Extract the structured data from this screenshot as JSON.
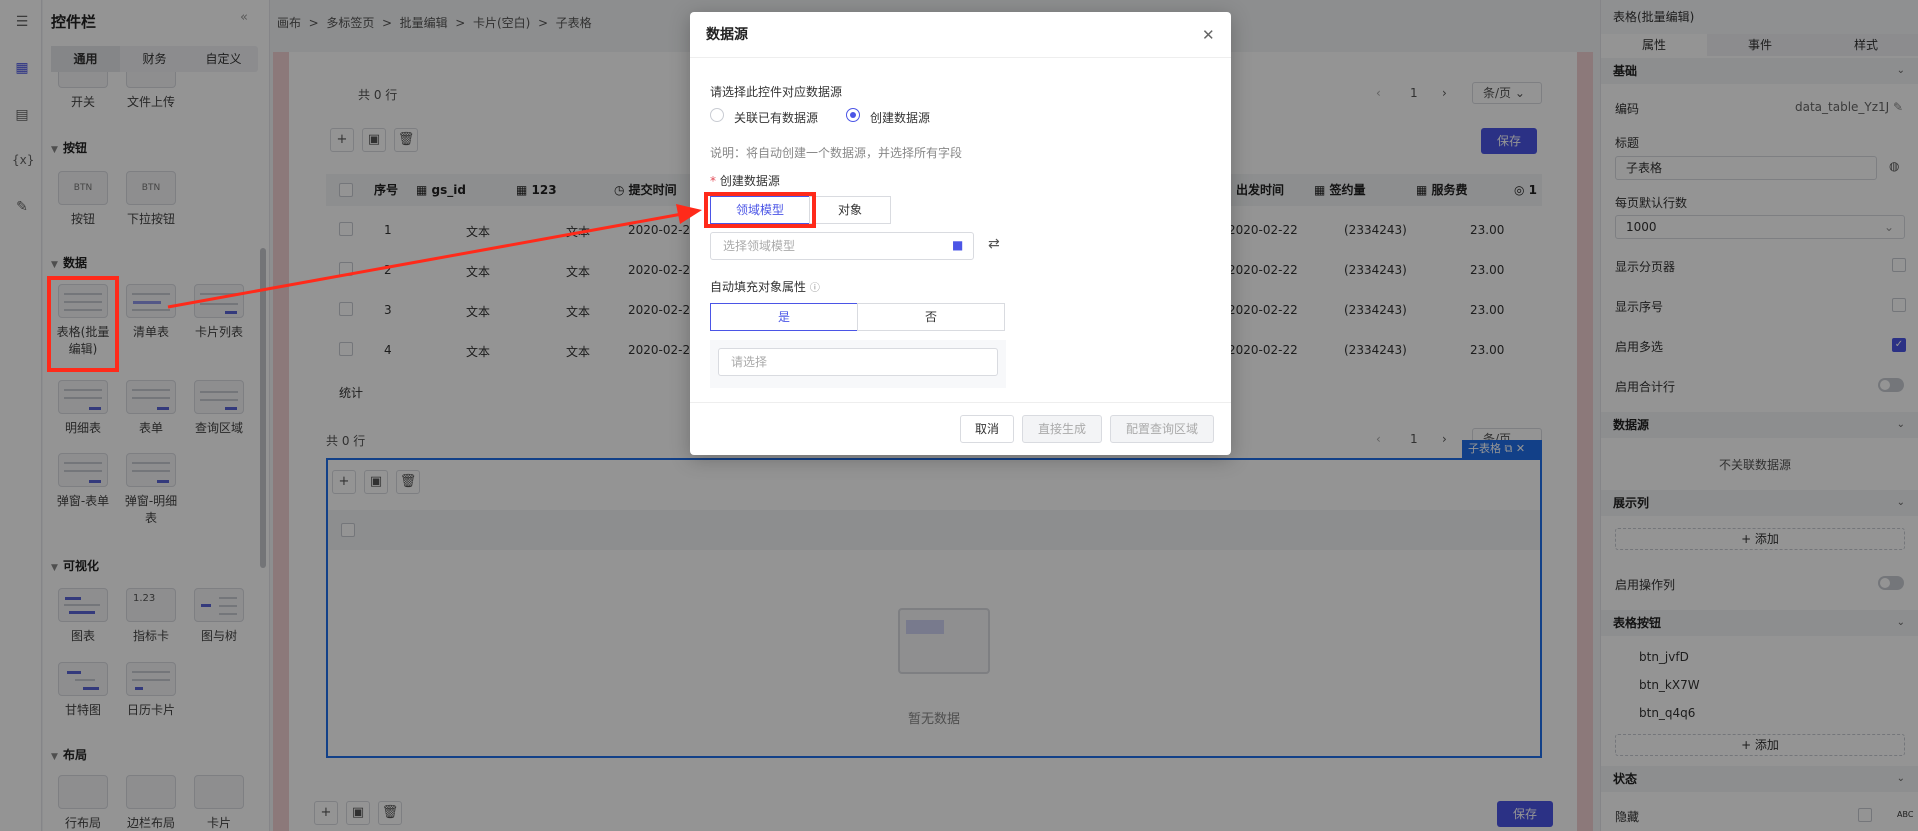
{
  "rail": {
    "icons": [
      "outline-icon",
      "components-icon",
      "datasource-icon",
      "variable-icon",
      "edit-icon"
    ],
    "variable_label": "{x}"
  },
  "widgets": {
    "title": "控件栏",
    "tabs": [
      "通用",
      "财务",
      "自定义"
    ],
    "top_items": [
      "开关",
      "文件上传"
    ],
    "sections": {
      "button": "按钮",
      "data": "数据",
      "visual": "可视化",
      "layout": "布局"
    },
    "button_items": [
      "按钮",
      "下拉按钮"
    ],
    "button_thumbs": [
      "BTN",
      "BTN"
    ],
    "data_items": [
      "表格(批量编辑)",
      "清单表",
      "卡片列表",
      "明细表",
      "表单",
      "查询区域",
      "弹窗-表单",
      "弹窗-明细表"
    ],
    "visual_items": [
      "图表",
      "指标卡",
      "图与树",
      "甘特图",
      "日历卡片"
    ],
    "visual_thumb_num": "1.23",
    "layout_items": [
      "行布局",
      "边栏布局",
      "卡片"
    ]
  },
  "breadcrumb": [
    "画布",
    "多标签页",
    "批量编辑",
    "卡片(空白)",
    "子表格"
  ],
  "canvas": {
    "total_rows": "共 0 行",
    "page": "1",
    "page_size": "条/页",
    "save": "保存",
    "columns": [
      "序号",
      "gs_id",
      "123",
      "提交时间",
      "出发时间",
      "签约量",
      "服务费"
    ],
    "rows": [
      {
        "no": "1",
        "a": "文本",
        "b": "文本",
        "c": "2020-02-22",
        "d": "2020-02-22",
        "e": "(2334243)",
        "f": "23.00"
      },
      {
        "no": "2",
        "a": "文本",
        "b": "文本",
        "c": "2020-02-22",
        "d": "2020-02-22",
        "e": "(2334243)",
        "f": "23.00"
      },
      {
        "no": "3",
        "a": "文本",
        "b": "文本",
        "c": "2020-02-22",
        "d": "2020-02-22",
        "e": "(2334243)",
        "f": "23.00"
      },
      {
        "no": "4",
        "a": "文本",
        "b": "文本",
        "c": "2020-02-22",
        "d": "2020-02-22",
        "e": "(2334243)",
        "f": "23.00"
      }
    ],
    "summary": "统计",
    "sub_tag": "子表格",
    "empty": "暂无数据",
    "page_size_short": "条/页"
  },
  "dialog": {
    "title": "数据源",
    "prompt": "请选择此控件对应数据源",
    "opt_link": "关联已有数据源",
    "opt_create": "创建数据源",
    "note": "说明：将自动创建一个数据源，并选择所有字段",
    "create_label": "创建数据源",
    "required": "*",
    "seg_domain": "领域模型",
    "seg_object": "对象",
    "model_placeholder": "选择领域模型",
    "autofill_label": "自动填充对象属性",
    "yes": "是",
    "no": "否",
    "select_placeholder": "请选择",
    "cancel": "取消",
    "generate": "直接生成",
    "config_query": "配置查询区域"
  },
  "props": {
    "header": "表格(批量编辑)",
    "tabs": [
      "属性",
      "事件",
      "样式"
    ],
    "sec_basic": "基础",
    "code_label": "编码",
    "code_value": "data_table_Yz1J",
    "title_label": "标题",
    "title_value": "子表格",
    "page_size_label": "每页默认行数",
    "page_size_value": "1000",
    "show_pager": "显示分页器",
    "show_index": "显示序号",
    "multi_select": "启用多选",
    "total_row": "启用合计行",
    "sec_datasource": "数据源",
    "no_datasource": "不关联数据源",
    "sec_columns": "展示列",
    "add": "+ 添加",
    "op_column": "启用操作列",
    "sec_buttons": "表格按钮",
    "buttons": [
      "btn_jvfD",
      "btn_kX7W",
      "btn_q4q6"
    ],
    "sec_state": "状态",
    "hidden": "隐藏",
    "abc": "ABC"
  },
  "colors": {
    "accent": "#4b55e6",
    "annotation": "#ff2a1a",
    "selection": "#1f6feb"
  }
}
